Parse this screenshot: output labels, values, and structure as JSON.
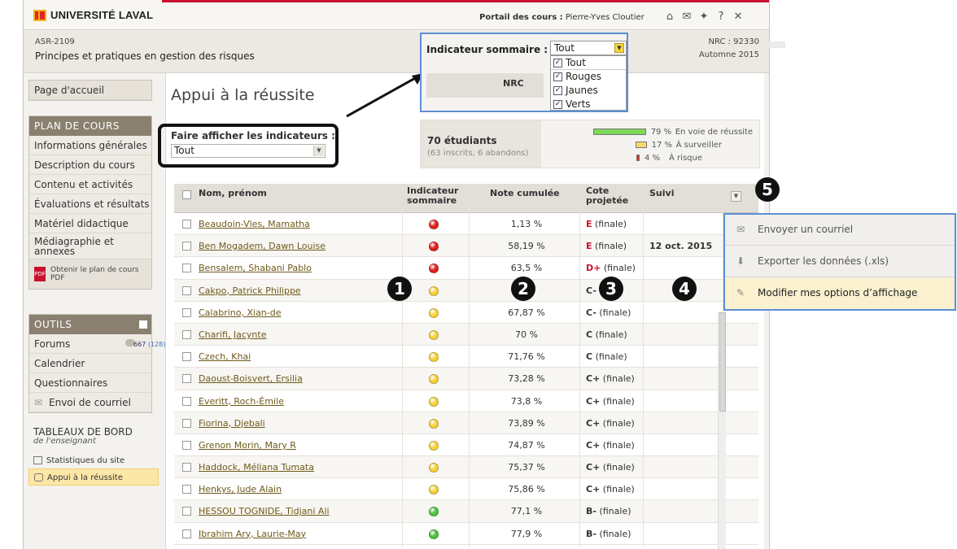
{
  "header": {
    "university": "UNIVERSITÉ LAVAL",
    "portal_label": "Portail des cours :",
    "portal_user": "Pierre-Yves Cloutier",
    "icons": [
      "home-icon",
      "mail-icon",
      "lightbulb-icon",
      "help-icon",
      "close-icon"
    ],
    "help_glyph": "?",
    "close_glyph": "✕"
  },
  "course": {
    "code": "ASR-2109",
    "title": "Principes et pratiques en gestion des risques",
    "nrc": "NRC : 92330",
    "term": "Automne 2015"
  },
  "sidebar": {
    "home": "Page d'accueil",
    "plan_head": "PLAN DE COURS",
    "plan_items": [
      "Informations générales",
      "Description du cours",
      "Contenu et activités",
      "Évaluations et résultats",
      "Matériel didactique",
      "Médiagraphie et annexes"
    ],
    "pdf": "Obtenir le plan de cours PDF",
    "tools_head": "OUTILS",
    "forums": "Forums",
    "forum_count": "667",
    "forum_new": "(128)",
    "tools_items": [
      "Calendrier",
      "Questionnaires"
    ],
    "mail": "Envoi de courriel",
    "dash_title": "TABLEAUX DE BORD",
    "dash_sub": "de l'enseignant",
    "dash_items": [
      "Statistiques du site",
      "Appui à la réussite"
    ]
  },
  "main": {
    "title": "Appui à la réussite",
    "filter_label": "Faire afficher les indicateurs :",
    "filter_value": "Tout",
    "stats": {
      "count": "70 étudiants",
      "detail": "(63 inscrits, 6 abandons)",
      "rows": [
        {
          "pct": "79 %",
          "label": "En voie de réussite",
          "fraction": 0.79,
          "color": "#7ed957"
        },
        {
          "pct": "17 %",
          "label": "À surveiller",
          "fraction": 0.17,
          "color": "#f7d86b"
        },
        {
          "pct": "4 %",
          "label": "À risque",
          "fraction": 0.04,
          "color": "#d92b2b"
        }
      ]
    },
    "columns": {
      "name": "Nom, prénom",
      "indicator_1": "Indicateur",
      "indicator_2": "sommaire",
      "note": "Note cumulée",
      "cote_1": "Cote",
      "cote_2": "projetée",
      "suivi": "Suivi"
    },
    "rows": [
      {
        "name": "Beaudoin-Vles, Mamatha",
        "status": "red",
        "note": "1,13 %",
        "grade": "E",
        "grade_suffix": "(finale)",
        "suivi": ""
      },
      {
        "name": "Ben Mogadem, Dawn Louise",
        "status": "red",
        "note": "58,19 %",
        "grade": "E",
        "grade_suffix": "(finale)",
        "suivi": "12 oct. 2015"
      },
      {
        "name": "Bensalem, Shabani Pablo",
        "status": "red",
        "note": "63,5 %",
        "grade": "D+",
        "grade_suffix": "(finale)",
        "suivi": ""
      },
      {
        "name": "Cakpo, Patrick Philippe",
        "status": "yellow",
        "note": "",
        "grade": "C-",
        "grade_suffix": "",
        "suivi": ""
      },
      {
        "name": "Calabrino, Xian-de",
        "status": "yellow",
        "note": "67,87 %",
        "grade": "C-",
        "grade_suffix": "(finale)",
        "suivi": ""
      },
      {
        "name": "Charifi, Jacynte",
        "status": "yellow",
        "note": "70 %",
        "grade": "C",
        "grade_suffix": "(finale)",
        "suivi": ""
      },
      {
        "name": "Czech, Khai",
        "status": "yellow",
        "note": "71,76 %",
        "grade": "C",
        "grade_suffix": "(finale)",
        "suivi": ""
      },
      {
        "name": "Daoust-Boisvert, Ersilia",
        "status": "yellow",
        "note": "73,28 %",
        "grade": "C+",
        "grade_suffix": "(finale)",
        "suivi": ""
      },
      {
        "name": "Everitt, Roch-Émile",
        "status": "yellow",
        "note": "73,8 %",
        "grade": "C+",
        "grade_suffix": "(finale)",
        "suivi": ""
      },
      {
        "name": "Fiorina, Djebali",
        "status": "yellow",
        "note": "73,89 %",
        "grade": "C+",
        "grade_suffix": "(finale)",
        "suivi": ""
      },
      {
        "name": "Grenon Morin, Mary R",
        "status": "yellow",
        "note": "74,87 %",
        "grade": "C+",
        "grade_suffix": "(finale)",
        "suivi": ""
      },
      {
        "name": "Haddock, Méliana Tumata",
        "status": "yellow",
        "note": "75,37 %",
        "grade": "C+",
        "grade_suffix": "(finale)",
        "suivi": ""
      },
      {
        "name": "Henkys, Jude Alain",
        "status": "yellow",
        "note": "75,86 %",
        "grade": "C+",
        "grade_suffix": "(finale)",
        "suivi": ""
      },
      {
        "name": "HESSOU TOGNIDE, Tidjani Ali",
        "status": "green",
        "note": "77,1 %",
        "grade": "B-",
        "grade_suffix": "(finale)",
        "suivi": ""
      },
      {
        "name": "Ibrahim Ary, Laurie-May",
        "status": "green",
        "note": "77,9 %",
        "grade": "B-",
        "grade_suffix": "(finale)",
        "suivi": ""
      }
    ]
  },
  "popup": {
    "label": "Indicateur sommaire :",
    "value": "Tout",
    "options": [
      "Tout",
      "Rouges",
      "Jaunes",
      "Verts"
    ],
    "nrc_col": "NRC",
    "check_glyph": "✓"
  },
  "actions_menu": {
    "items": [
      "Envoyer un courriel",
      "Exporter les données (.xls)",
      "Modifier mes options d’affichage"
    ],
    "icons": [
      "envelope-icon",
      "download-icon",
      "pencil-icon"
    ]
  },
  "badges": [
    "1",
    "2",
    "3",
    "4",
    "5"
  ],
  "colors": {
    "red": "#e0201c",
    "yellow": "#f6d23a",
    "green": "#4cc23a",
    "accent": "#c8102e",
    "highlight": "#5c8fd6"
  }
}
